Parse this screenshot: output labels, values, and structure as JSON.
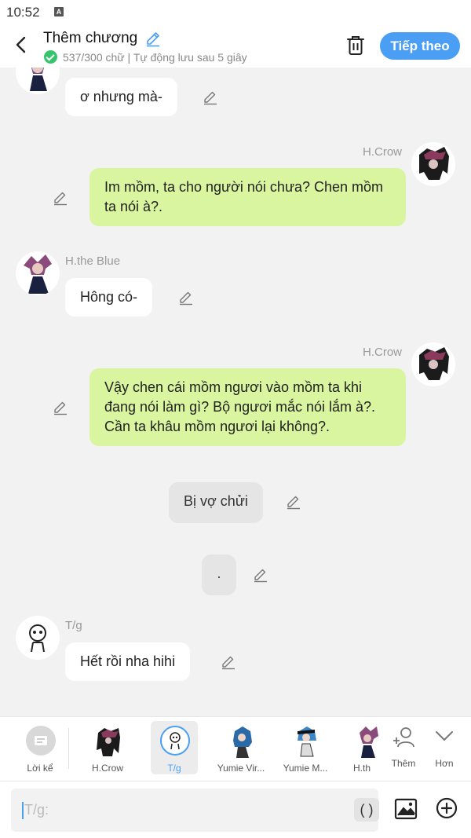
{
  "status": {
    "time": "10:52",
    "notif_icon": "A"
  },
  "header": {
    "title": "Thêm chương",
    "subtitle": "537/300 chữ | Tự động lưu sau 5 giây",
    "next_label": "Tiếp theo"
  },
  "messages": [
    {
      "type": "left",
      "text": "ơ nhưng mà-"
    },
    {
      "type": "right",
      "name": "H.Crow",
      "text": "Im mồm, ta cho người nói chưa? Chen mồm ta nói à?."
    },
    {
      "type": "left",
      "name": "H.the Blue",
      "text": "Hông có-"
    },
    {
      "type": "right",
      "name": "H.Crow",
      "text": "Vậy chen cái mồm ngươi vào mồm ta khi đang nói làm gì? Bộ ngươi mắc nói lắm à?. Cần ta khâu mồm ngươi lại không?."
    },
    {
      "type": "center",
      "text": "Bị vợ chửi"
    },
    {
      "type": "center",
      "text": "."
    },
    {
      "type": "left",
      "name": "T/g",
      "text": "Hết rồi nha hihi"
    }
  ],
  "characters": [
    {
      "label": "Lời kể"
    },
    {
      "label": "H.Crow"
    },
    {
      "label": "T/g",
      "selected": true
    },
    {
      "label": "Yumie Vir..."
    },
    {
      "label": "Yumie M..."
    },
    {
      "label": "H.th"
    }
  ],
  "actions": {
    "add_label": "Thêm",
    "more_label": "Hơn"
  },
  "input": {
    "placeholder": "T/g:",
    "paren_label": "( )"
  },
  "colors": {
    "accent": "#4a9ff5",
    "right_bubble": "#d9f59f",
    "left_bubble": "#ffffff",
    "check": "#35c46b"
  }
}
